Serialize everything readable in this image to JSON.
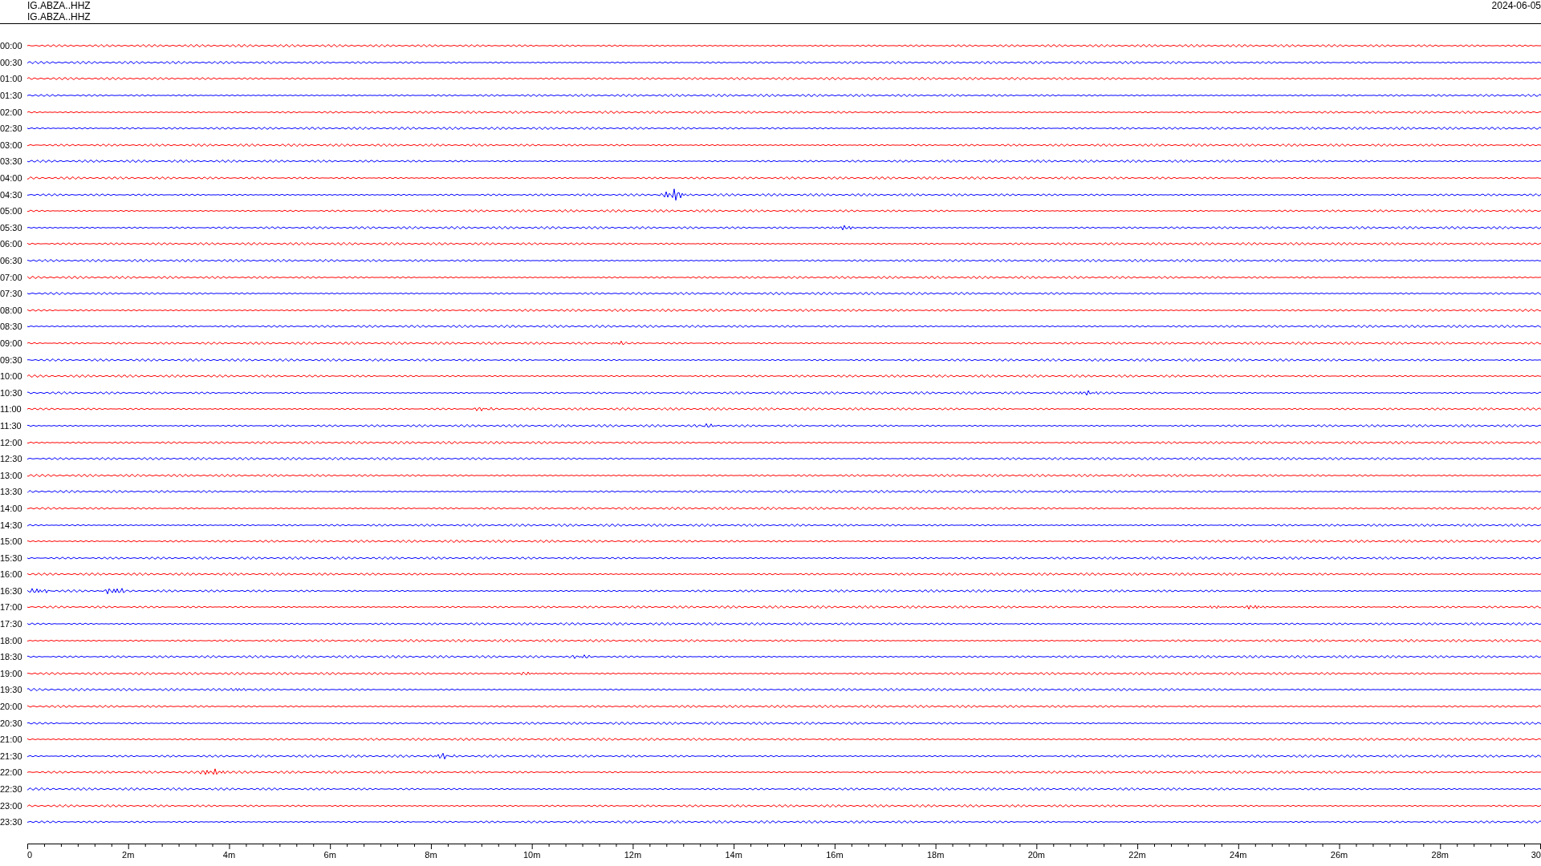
{
  "header": {
    "station_lines": [
      "IG.ABZA..HHZ",
      "IG.ABZA..HHZ"
    ],
    "date": "2024-06-05"
  },
  "rows": [
    {
      "label": "00:00",
      "color": "#ff0000"
    },
    {
      "label": "00:30",
      "color": "#0000ff"
    },
    {
      "label": "01:00",
      "color": "#ff0000"
    },
    {
      "label": "01:30",
      "color": "#0000ff"
    },
    {
      "label": "02:00",
      "color": "#ff0000"
    },
    {
      "label": "02:30",
      "color": "#0000ff"
    },
    {
      "label": "03:00",
      "color": "#ff0000"
    },
    {
      "label": "03:30",
      "color": "#0000ff"
    },
    {
      "label": "04:00",
      "color": "#ff0000"
    },
    {
      "label": "04:30",
      "color": "#0000ff"
    },
    {
      "label": "05:00",
      "color": "#ff0000"
    },
    {
      "label": "05:30",
      "color": "#0000ff"
    },
    {
      "label": "06:00",
      "color": "#ff0000"
    },
    {
      "label": "06:30",
      "color": "#0000ff"
    },
    {
      "label": "07:00",
      "color": "#ff0000"
    },
    {
      "label": "07:30",
      "color": "#0000ff"
    },
    {
      "label": "08:00",
      "color": "#ff0000"
    },
    {
      "label": "08:30",
      "color": "#0000ff"
    },
    {
      "label": "09:00",
      "color": "#ff0000"
    },
    {
      "label": "09:30",
      "color": "#0000ff"
    },
    {
      "label": "10:00",
      "color": "#ff0000"
    },
    {
      "label": "10:30",
      "color": "#0000ff"
    },
    {
      "label": "11:00",
      "color": "#ff0000"
    },
    {
      "label": "11:30",
      "color": "#0000ff"
    },
    {
      "label": "12:00",
      "color": "#ff0000"
    },
    {
      "label": "12:30",
      "color": "#0000ff"
    },
    {
      "label": "13:00",
      "color": "#ff0000"
    },
    {
      "label": "13:30",
      "color": "#0000ff"
    },
    {
      "label": "14:00",
      "color": "#ff0000"
    },
    {
      "label": "14:30",
      "color": "#0000ff"
    },
    {
      "label": "15:00",
      "color": "#ff0000"
    },
    {
      "label": "15:30",
      "color": "#0000ff"
    },
    {
      "label": "16:00",
      "color": "#ff0000"
    },
    {
      "label": "16:30",
      "color": "#0000ff"
    },
    {
      "label": "17:00",
      "color": "#ff0000"
    },
    {
      "label": "17:30",
      "color": "#0000ff"
    },
    {
      "label": "18:00",
      "color": "#ff0000"
    },
    {
      "label": "18:30",
      "color": "#0000ff"
    },
    {
      "label": "19:00",
      "color": "#ff0000"
    },
    {
      "label": "19:30",
      "color": "#0000ff"
    },
    {
      "label": "20:00",
      "color": "#ff0000"
    },
    {
      "label": "20:30",
      "color": "#0000ff"
    },
    {
      "label": "21:00",
      "color": "#ff0000"
    },
    {
      "label": "21:30",
      "color": "#0000ff"
    },
    {
      "label": "22:00",
      "color": "#ff0000"
    },
    {
      "label": "22:30",
      "color": "#0000ff"
    },
    {
      "label": "23:00",
      "color": "#ff0000"
    },
    {
      "label": "23:30",
      "color": "#0000ff"
    }
  ],
  "time_axis": {
    "labels": [
      "0",
      "2m",
      "4m",
      "6m",
      "8m",
      "10m",
      "12m",
      "14m",
      "16m",
      "18m",
      "20m",
      "22m",
      "24m",
      "26m",
      "28m",
      "30"
    ]
  }
}
